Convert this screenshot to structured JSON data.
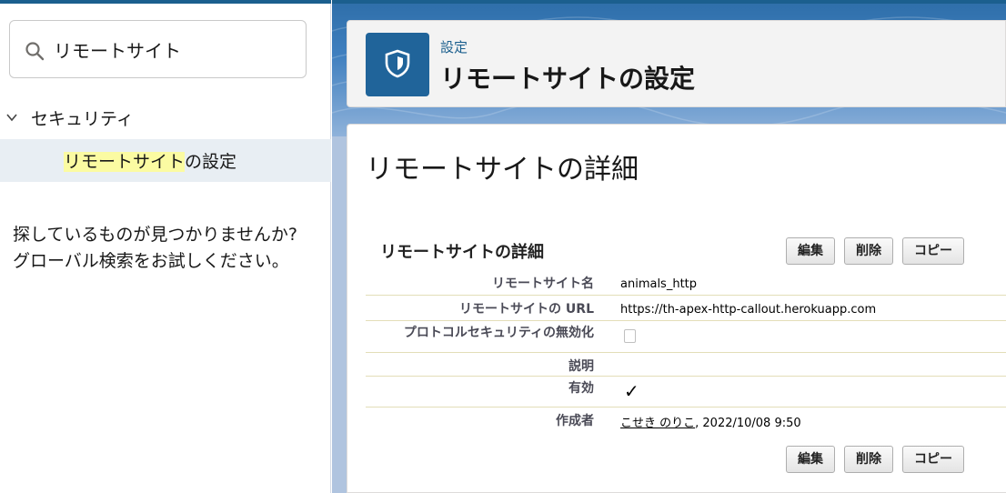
{
  "sidebar": {
    "search": {
      "value": "リモートサイト",
      "placeholder": ""
    },
    "tree": {
      "parent_label": "セキュリティ",
      "child_label_match": "リモートサイト",
      "child_label_rest": "の設定"
    },
    "not_found": {
      "line1": "探しているものが見つかりませんか?",
      "line2": "グローバル検索をお試しください。"
    }
  },
  "header": {
    "breadcrumb": "設定",
    "title": "リモートサイトの設定",
    "icon": "shield-icon"
  },
  "content": {
    "title": "リモートサイトの詳細",
    "section_title": "リモートサイトの詳細",
    "buttons": {
      "edit": "編集",
      "delete": "削除",
      "copy": "コピー"
    },
    "fields": {
      "name_label": "リモートサイト名",
      "name_value": "animals_http",
      "url_label": "リモートサイトの URL",
      "url_value": "https://th-apex-http-callout.herokuapp.com",
      "disable_protocol_label": "プロトコルセキュリティの無効化",
      "disable_protocol_value": false,
      "description_label": "説明",
      "description_value": "",
      "active_label": "有効",
      "active_value": true,
      "created_by_label": "作成者",
      "created_by_user": "こせき のりこ",
      "created_by_date": ", 2022/10/08 9:50"
    }
  },
  "colors": {
    "brand": "#1b5f8e",
    "header_icon_bg": "#20649a",
    "highlight": "#fbfba2",
    "selected_row": "#e8eef3"
  }
}
